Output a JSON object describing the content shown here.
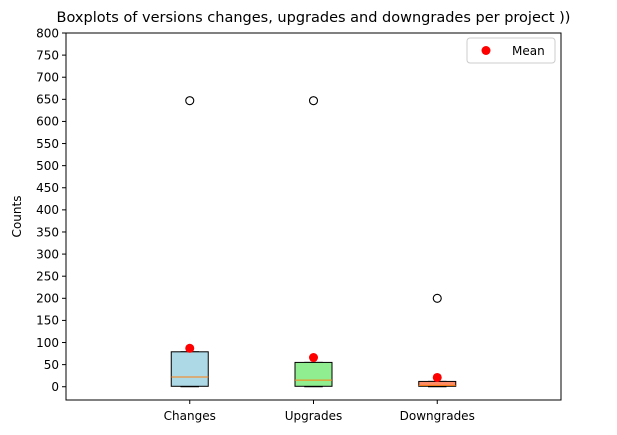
{
  "chart_data": {
    "type": "boxplot",
    "title": "Boxplots of versions changes, upgrades and downgrades per project ))",
    "xlabel": "",
    "ylabel": "Counts",
    "ylim": [
      -30,
      800
    ],
    "yticks": [
      0,
      50,
      100,
      150,
      200,
      250,
      300,
      350,
      400,
      450,
      500,
      550,
      600,
      650,
      700,
      750,
      800
    ],
    "grid": false,
    "legend": {
      "placement": "top-right",
      "entries": [
        {
          "label": "Mean",
          "color": "#ff0000"
        }
      ]
    },
    "categories": [
      "Changes",
      "Upgrades",
      "Downgrades"
    ],
    "boxes": [
      {
        "name": "Changes",
        "whisker_low": 0,
        "q1": 1,
        "median": 22,
        "q3": 79,
        "whisker_high": 79,
        "outliers": [
          647
        ],
        "mean": 87,
        "fill": "#add8e6"
      },
      {
        "name": "Upgrades",
        "whisker_low": 0,
        "q1": 1,
        "median": 15,
        "q3": 55,
        "whisker_high": 55,
        "outliers": [
          647
        ],
        "mean": 66,
        "fill": "#90ee90"
      },
      {
        "name": "Downgrades",
        "whisker_low": 0,
        "q1": 1,
        "median": 3,
        "q3": 12,
        "whisker_high": 12,
        "outliers": [
          200
        ],
        "mean": 21,
        "fill": "#ff8c69"
      }
    ],
    "colors": {
      "median": "#ff7f0e",
      "mean": "#ff0000",
      "box_edge": "#000000"
    }
  }
}
